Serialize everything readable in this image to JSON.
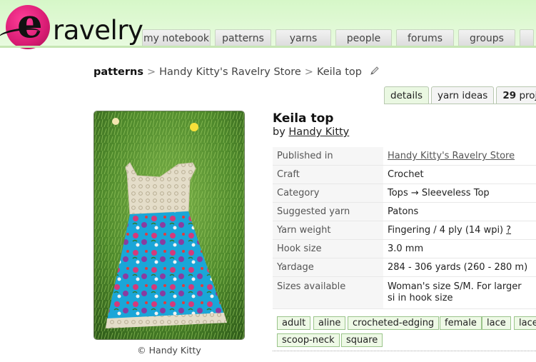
{
  "header": {
    "logo_text": "ravelry",
    "nav": [
      {
        "label": "my notebook"
      },
      {
        "label": "patterns"
      },
      {
        "label": "yarns"
      },
      {
        "label": "people"
      },
      {
        "label": "forums"
      },
      {
        "label": "groups"
      }
    ]
  },
  "breadcrumb": {
    "root": "patterns",
    "sep": ">",
    "store": "Handy Kitty's Ravelry Store",
    "current": "Keila top"
  },
  "subtabs": {
    "details": "details",
    "yarn_ideas": "yarn ideas",
    "projects_count": "29",
    "projects_label": "proje"
  },
  "photo": {
    "caption": "© Handy Kitty"
  },
  "pattern": {
    "title": "Keila top",
    "by_label": "by",
    "designer": "Handy Kitty"
  },
  "details": [
    {
      "key": "Published in",
      "value": "Handy Kitty's Ravelry Store"
    },
    {
      "key": "Craft",
      "value": "Crochet"
    },
    {
      "key": "Category",
      "value": "Tops → Sleeveless Top"
    },
    {
      "key": "Suggested yarn",
      "value": "Patons"
    },
    {
      "key": "Yarn weight",
      "value": "Fingering / 4 ply (14 wpi)",
      "help": "?"
    },
    {
      "key": "Hook size",
      "value": "3.0 mm"
    },
    {
      "key": "Yardage",
      "value": "284 - 306 yards (260 - 280 m)"
    },
    {
      "key": "Sizes available",
      "value": "Woman's size S/M. For larger si in hook size"
    }
  ],
  "tags": [
    "adult",
    "aline",
    "crocheted-edging",
    "female",
    "lace",
    "lace",
    "scoop-neck",
    "square"
  ],
  "colors": {
    "header_bg": "#d6f7c8",
    "logo_pink": "#e01f7a",
    "tag_bg": "#eef9e6",
    "tag_border": "#9ac48a"
  }
}
